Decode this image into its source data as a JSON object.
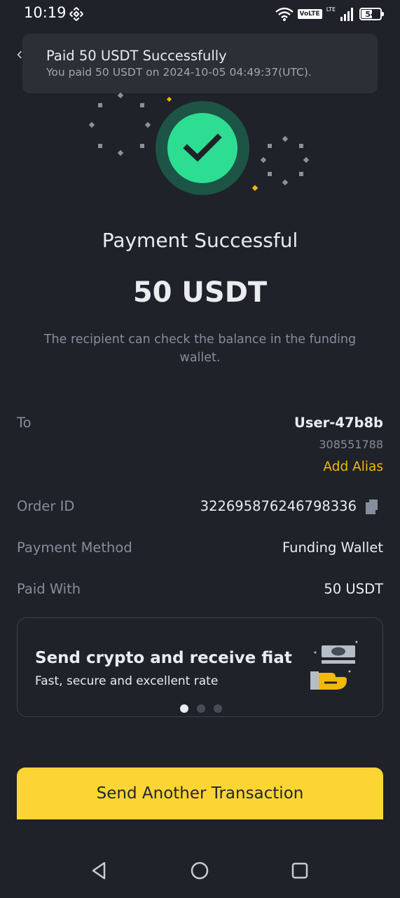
{
  "status_bar": {
    "time": "10:19",
    "volte": "VoLTE",
    "lte": "LTE",
    "battery": "54",
    "icons": [
      "binance-icon",
      "wifi-icon",
      "signal-icon",
      "battery-icon"
    ]
  },
  "toast": {
    "title": "Paid 50 USDT Successfully",
    "subtitle": "You paid 50 USDT on 2024-10-05 04:49:37(UTC)."
  },
  "result": {
    "title": "Payment Successful",
    "amount": "50 USDT",
    "note": "The recipient can check the balance in the funding wallet."
  },
  "details": {
    "to_label": "To",
    "to_name": "User-47b8b",
    "to_uid": "308551788",
    "add_alias": "Add Alias",
    "order_label": "Order ID",
    "order_id": "322695876246798336",
    "method_label": "Payment Method",
    "method_value": "Funding Wallet",
    "paid_label": "Paid With",
    "paid_value": "50 USDT"
  },
  "banner": {
    "title": "Send crypto and receive fiat",
    "subtitle": "Fast, secure and excellent rate",
    "page_count": 3,
    "active_page": 1
  },
  "cta": {
    "label": "Send Another Transaction"
  },
  "colors": {
    "background": "#1f2229",
    "accent": "#fcd535",
    "success": "#2ddd92",
    "link": "#f0b90b",
    "muted": "#848e9c"
  }
}
